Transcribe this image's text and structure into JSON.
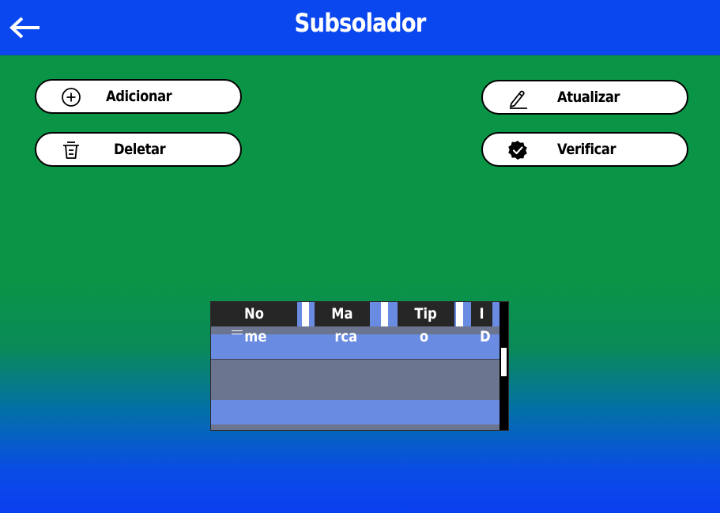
{
  "header": {
    "title": "Subsolador",
    "back_icon": "arrow-left-icon"
  },
  "colors": {
    "topbar": "#0b47ee",
    "background_top": "#0a9446",
    "background_bottom": "#0a40f0",
    "row_highlight": "#6a8be2",
    "row_default": "#6b7590",
    "table_header": "#262626"
  },
  "actions": {
    "add": {
      "label": "Adicionar",
      "icon": "plus-circle-icon"
    },
    "update": {
      "label": "Atualizar",
      "icon": "pencil-icon"
    },
    "delete": {
      "label": "Deletar",
      "icon": "trash-icon"
    },
    "verify": {
      "label": "Verificar",
      "icon": "verified-badge-icon"
    }
  },
  "table": {
    "columns": [
      {
        "line1": "No",
        "line2": "me"
      },
      {
        "line1": "Ma",
        "line2": "rca"
      },
      {
        "line1": "Tip",
        "line2": "o"
      },
      {
        "line1": "I",
        "line2": "D"
      }
    ],
    "rows": [
      {
        "nome": "",
        "marca": "",
        "tipo": "",
        "id": ""
      },
      {
        "nome": "",
        "marca": "",
        "tipo": "",
        "id": ""
      },
      {
        "nome": "",
        "marca": "",
        "tipo": "",
        "id": ""
      }
    ]
  }
}
